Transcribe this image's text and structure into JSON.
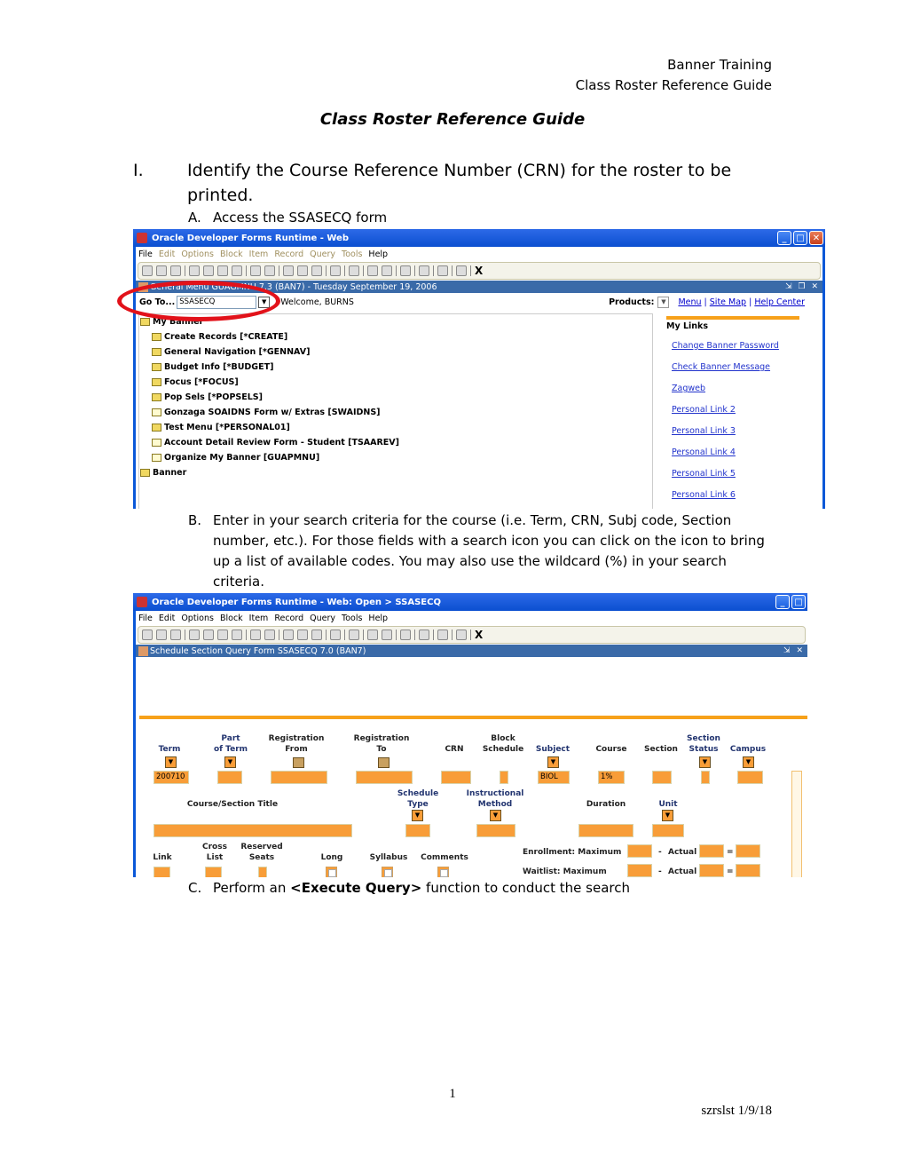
{
  "header": {
    "line1": "Banner Training",
    "line2": "Class Roster Reference Guide"
  },
  "title": "Class Roster Reference Guide",
  "section": {
    "number": "I.",
    "text": "Identify the Course Reference Number (CRN) for the roster to be printed."
  },
  "steps": {
    "a": {
      "label": "A.",
      "text": "Access the SSASECQ form"
    },
    "b": {
      "label": "B.",
      "text": "Enter in your search criteria for the course (i.e. Term, CRN, Subj code, Section number, etc.).  For those fields with a search icon you can click on the icon to bring up a list of available codes.  You may also use the wildcard (%) in your search criteria."
    },
    "c": {
      "label": "C.",
      "pre": "Perform an ",
      "bold": "<Execute Query>",
      "post": " function to conduct the search"
    }
  },
  "window1": {
    "title": "Oracle Developer Forms Runtime - Web",
    "menu": [
      "File",
      "Edit",
      "Options",
      "Block",
      "Item",
      "Record",
      "Query",
      "Tools",
      "Help"
    ],
    "subtitle": "General Menu  GUAGMNU  7.3  (BAN7) - Tuesday September 19, 2006",
    "goto_label": "Go To...",
    "goto_value": "SSASECQ",
    "welcome": "Welcome, BURNS",
    "products_label": "Products:",
    "top_links": [
      "Menu",
      "Site Map",
      "Help Center"
    ],
    "tree": [
      {
        "label": "My Banner",
        "type": "folder",
        "level": 0
      },
      {
        "label": "Create Records [*CREATE]",
        "type": "folder",
        "level": 1
      },
      {
        "label": "General Navigation [*GENNAV]",
        "type": "folder",
        "level": 1
      },
      {
        "label": "Budget Info [*BUDGET]",
        "type": "folder",
        "level": 1
      },
      {
        "label": "Focus [*FOCUS]",
        "type": "folder",
        "level": 1
      },
      {
        "label": "Pop Sels [*POPSELS]",
        "type": "folder",
        "level": 1
      },
      {
        "label": "Gonzaga SOAIDNS Form w/ Extras [SWAIDNS]",
        "type": "doc",
        "level": 1
      },
      {
        "label": "Test Menu [*PERSONAL01]",
        "type": "folder",
        "level": 1
      },
      {
        "label": "Account Detail Review Form - Student [TSAAREV]",
        "type": "doc",
        "level": 1
      },
      {
        "label": "Organize My Banner [GUAPMNU]",
        "type": "doc",
        "level": 1
      },
      {
        "label": "Banner",
        "type": "folder",
        "level": 0
      }
    ],
    "my_links_title": "My Links",
    "my_links": [
      "Change Banner Password",
      "Check Banner Message",
      "Zagweb",
      "Personal Link 2",
      "Personal Link 3",
      "Personal Link 4",
      "Personal Link 5",
      "Personal Link 6"
    ]
  },
  "window2": {
    "title": "Oracle Developer Forms Runtime - Web:  Open > SSASECQ",
    "menu": [
      "File",
      "Edit",
      "Options",
      "Block",
      "Item",
      "Record",
      "Query",
      "Tools",
      "Help"
    ],
    "subtitle": "Schedule Section Query Form  SSASECQ  7.0  (BAN7)",
    "labels": {
      "term": "Term",
      "part_of_term": "Part\nof Term",
      "reg_from": "Registration\nFrom",
      "reg_to": "Registration\nTo",
      "crn": "CRN",
      "block_schedule": "Block\nSchedule",
      "subject": "Subject",
      "course": "Course",
      "section": "Section",
      "section_status": "Section\nStatus",
      "campus": "Campus",
      "title": "Course/Section Title",
      "schedule_type": "Schedule\nType",
      "instr_method": "Instructional\nMethod",
      "duration": "Duration",
      "unit": "Unit",
      "link": "Link",
      "cross_list": "Cross\nList",
      "reserved_seats": "Reserved\nSeats",
      "long": "Long",
      "syllabus": "Syllabus",
      "comments": "Comments",
      "enroll_max": "Enrollment: Maximum",
      "wait_max": "Waitlist: Maximum",
      "actual": "Actual",
      "minus": "-",
      "equals": "="
    },
    "values": {
      "term": "200710",
      "subject": "BIOL",
      "course": "1%"
    }
  },
  "footer": {
    "page": "1",
    "doc_id": "szrslst 1/9/18"
  }
}
